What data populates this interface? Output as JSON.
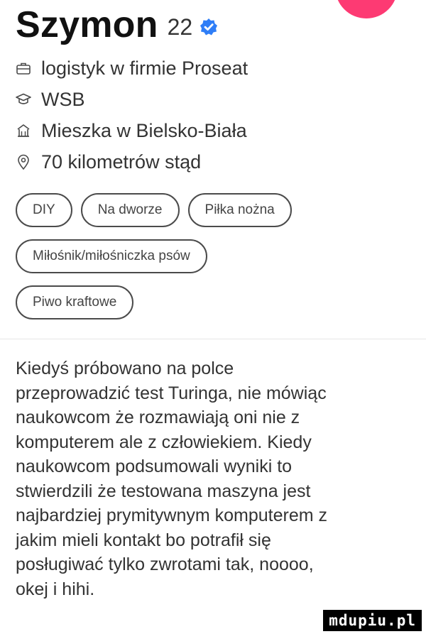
{
  "profile": {
    "name": "Szymon",
    "age": "22",
    "verified_icon": "verified-badge-icon",
    "accent_color": "#fd3a73",
    "verified_color": "#2f7ef7"
  },
  "info": [
    {
      "icon": "briefcase-icon",
      "text": "logistyk w firmie Proseat"
    },
    {
      "icon": "graduation-cap-icon",
      "text": "WSB"
    },
    {
      "icon": "home-icon",
      "text": "Mieszka w Bielsko-Biała"
    },
    {
      "icon": "location-pin-icon",
      "text": "70 kilometrów stąd"
    }
  ],
  "interests": [
    [
      "DIY",
      "Na dworze",
      "Piłka nożna"
    ],
    [
      "Miłośnik/miłośniczka psów"
    ],
    [
      "Piwo kraftowe"
    ]
  ],
  "bio": "Kiedyś próbowano na polce\nprzeprowadzić test Turinga, nie mówiąc\nnaukowcom że rozmawiają oni nie z\nkomputerem ale z człowiekiem. Kiedy\nnaukowcom podsumowali wyniki to\nstwierdzili że testowana maszyna jest\nnajbardziej prymitywnym komputerem z\njakim mieli kontakt bo potrafił się\nposługiwać tylko zwrotami tak, noooo,\nokej i hihi.",
  "watermark": "mdupiu.pl"
}
